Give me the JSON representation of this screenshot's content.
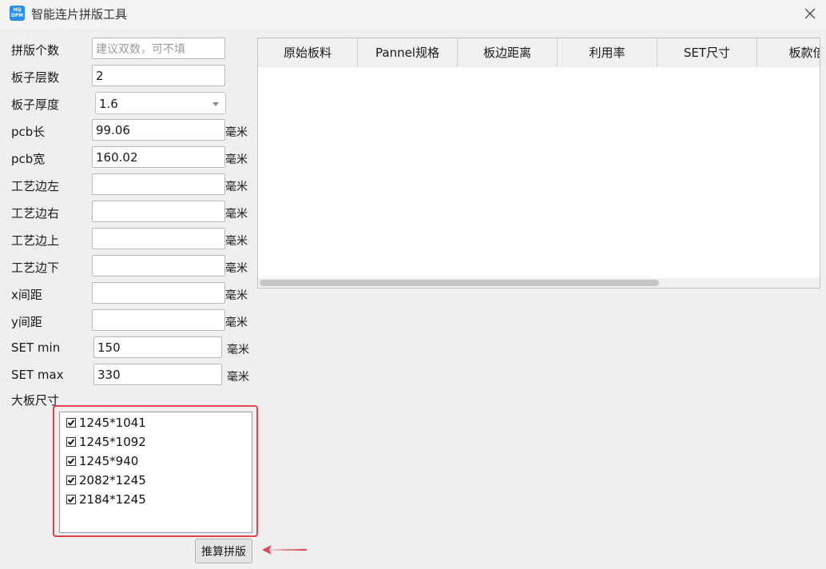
{
  "window": {
    "title": "智能连片拼版工具",
    "icon_text_top": "HQ",
    "icon_text_bottom": "DFM",
    "icon": "app-logo-icon",
    "close_icon": "close-icon"
  },
  "form": {
    "panel_count_label": "拼版个数",
    "panel_count_placeholder": "建议双数，可不填",
    "panel_count_value": "",
    "layers_label": "板子层数",
    "layers_value": "2",
    "thickness_label": "板子厚度",
    "thickness_value": "1.6",
    "pcb_length_label": "pcb长",
    "pcb_length_value": "99.06",
    "pcb_width_label": "pcb宽",
    "pcb_width_value": "160.02",
    "edge_left_label": "工艺边左",
    "edge_right_label": "工艺边右",
    "edge_top_label": "工艺边上",
    "edge_bottom_label": "工艺边下",
    "x_spacing_label": "x间距",
    "y_spacing_label": "y间距",
    "set_min_label": "SET min",
    "set_min_value": "150",
    "set_max_label": "SET max",
    "set_max_value": "330",
    "unit": "毫米",
    "board_size_label": "大板尺寸"
  },
  "board_sizes": [
    {
      "label": "1245*1041",
      "checked": true
    },
    {
      "label": "1245*1092",
      "checked": true
    },
    {
      "label": "1245*940",
      "checked": true
    },
    {
      "label": "2082*1245",
      "checked": true
    },
    {
      "label": "2184*1245",
      "checked": true
    }
  ],
  "calc_button": "推算拼版",
  "table": {
    "columns": [
      "原始板料",
      "Pannel规格",
      "板边距离",
      "利用率",
      "SET尺寸",
      "板款倍"
    ],
    "rows": []
  },
  "colors": {
    "highlight": "#e5424e",
    "accent": "#2a8ef0"
  }
}
